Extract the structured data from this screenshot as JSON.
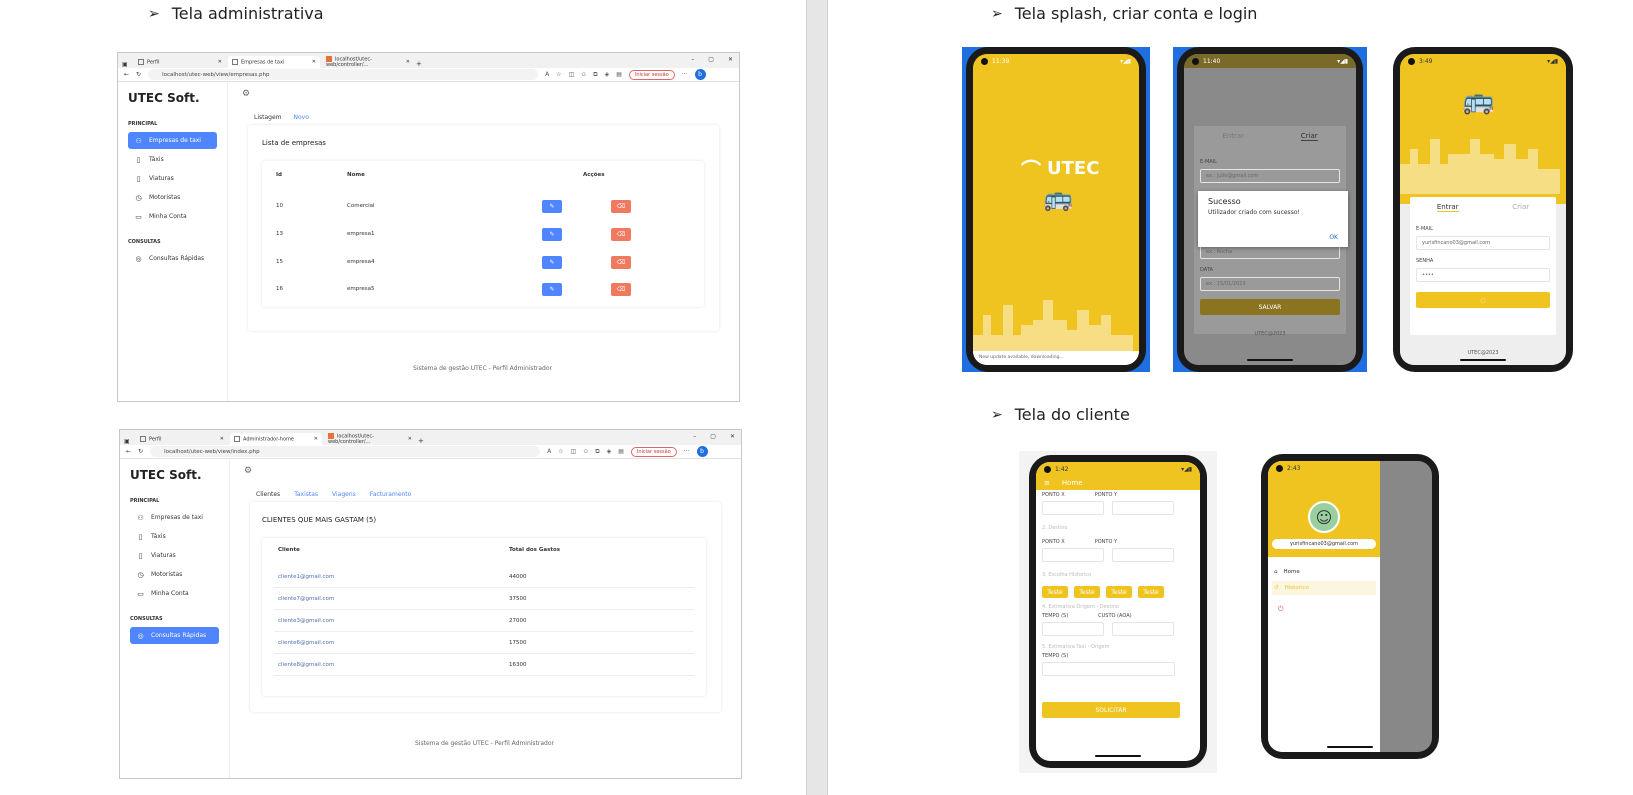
{
  "left_page": {
    "admin_heading": "Tela administrativa",
    "win1": {
      "tabs": [
        "Perfil",
        "Empresas de taxi",
        "localhost/utec-web/controller/..."
      ],
      "url": "localhost/utec-web/view/empresas.php",
      "session_button": "Iniciar sessão",
      "logo": "UTEC Soft.",
      "section_principal": "PRINCIPAL",
      "nav": [
        "Empresas de taxi",
        "Táxis",
        "Viaturas",
        "Motoristas",
        "Minha Conta"
      ],
      "section_consultas": "CONSULTAS",
      "nav2": [
        "Consultas Rápidas"
      ],
      "page_tabs": [
        "Listagem",
        "Novo"
      ],
      "card_title": "Lista de empresas",
      "columns": [
        "Id",
        "Nome",
        "Acções"
      ],
      "rows": [
        {
          "id": "10",
          "name": "Comercial"
        },
        {
          "id": "13",
          "name": "empresa1"
        },
        {
          "id": "15",
          "name": "empresa4"
        },
        {
          "id": "16",
          "name": "empresa5"
        }
      ],
      "footer": "Sistema de gestão UTEC - Perfil Administrador"
    },
    "win2": {
      "tabs": [
        "Perfil",
        "Administrador-home",
        "localhost/utec-web/controller/..."
      ],
      "url": "localhost/utec-web/view/index.php",
      "session_button": "Iniciar sessão",
      "logo": "UTEC Soft.",
      "section_principal": "PRINCIPAL",
      "nav": [
        "Empresas de taxi",
        "Táxis",
        "Viaturas",
        "Motoristas",
        "Minha Conta"
      ],
      "section_consultas": "CONSULTAS",
      "nav2": [
        "Consultas Rápidas"
      ],
      "page_tabs": [
        "Clientes",
        "Taxistas",
        "Viagens",
        "Facturamento"
      ],
      "card_title": "CLIENTES QUE MAIS GASTAM (5)",
      "columns": [
        "Cliente",
        "Total dos Gastos"
      ],
      "rows": [
        {
          "client": "cliente1@gmail.com",
          "total": "44000"
        },
        {
          "client": "cliente7@gmail.com",
          "total": "37500"
        },
        {
          "client": "cliente3@gmail.com",
          "total": "27000"
        },
        {
          "client": "cliente6@gmail.com",
          "total": "17500"
        },
        {
          "client": "cliente8@gmail.com",
          "total": "16300"
        }
      ],
      "footer": "Sistema de gestão UTEC - Perfil Administrador"
    }
  },
  "right_page": {
    "splash_heading": "Tela splash, criar conta e login",
    "client_heading": "Tela do cliente",
    "phone1": {
      "time": "11:39",
      "brand": "UTEC",
      "bottom_text": "New update available, downloading..."
    },
    "phone2": {
      "time": "11:40",
      "tabs": [
        "Entrar",
        "Criar"
      ],
      "email_label": "E-MAIL",
      "email_placeholder": "ex.: julio@gmail.com",
      "dialog_title": "Sucesso",
      "dialog_text": "Utilizador criado com sucesso!",
      "dialog_ok": "OK",
      "field_placeholder": "ex.: Rocha",
      "date_label": "DATA",
      "date_placeholder": "ex.: 15/01/2023",
      "submit": "SALVAR",
      "copyright": "UTEC@2023"
    },
    "phone3": {
      "time": "3:49",
      "tabs": [
        "Entrar",
        "Criar"
      ],
      "email_label": "E-MAIL",
      "email_value": "yurisfincano03@gmail.com",
      "password_label": "SENHA",
      "password_value": "••••",
      "copyright": "UTEC@2023"
    },
    "phone4": {
      "time": "1:42",
      "title": "Home",
      "labels": {
        "ponto_x": "PONTO X",
        "ponto_y": "PONTO Y"
      },
      "section_destino": "2. Destino",
      "section_historico": "3. Escolha Historico",
      "chips": [
        "Teste",
        "Teste",
        "Teste",
        "Teste"
      ],
      "section_estimativa": "4. Estimativa Origem - Destino",
      "tempo": "TEMPO (S)",
      "custo": "CUSTO (AOA)",
      "section_taxi": "5. Estimativa Taxi - Origem",
      "tempo2": "TEMPO (S)",
      "button": "SOLICITAR"
    },
    "phone5": {
      "time": "2:43",
      "email": "yurisfincano03@gmail.com",
      "menu": [
        "Home",
        "Historico"
      ]
    }
  }
}
